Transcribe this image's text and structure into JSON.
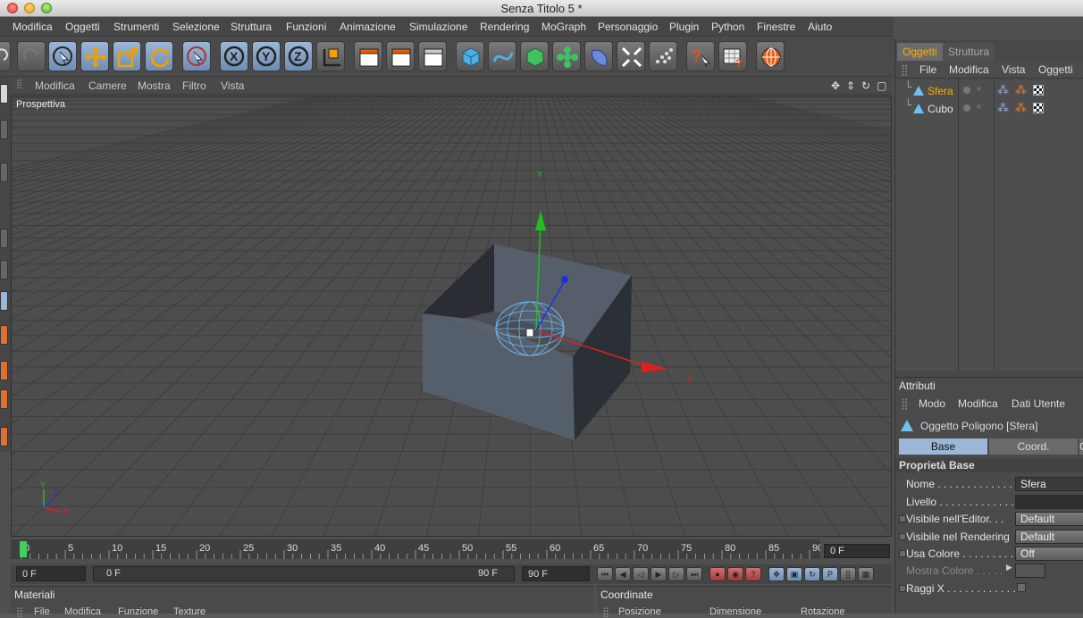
{
  "window": {
    "title": "Senza Titolo 5 *"
  },
  "menubar": [
    "Modifica",
    "Oggetti",
    "Strumenti",
    "Selezione",
    "Struttura",
    "Funzioni",
    "Animazione",
    "Simulazione",
    "Rendering",
    "MoGraph",
    "Personaggio",
    "Plugin",
    "Python",
    "Finestre",
    "Aiuto"
  ],
  "viewport": {
    "menu": [
      "Modifica",
      "Camere",
      "Mostra",
      "Filtro",
      "Vista"
    ],
    "label": "Prospettiva"
  },
  "timeline": {
    "ticks": [
      "0",
      "5",
      "10",
      "15",
      "20",
      "25",
      "30",
      "35",
      "40",
      "45",
      "50",
      "55",
      "60",
      "65",
      "70",
      "75",
      "80",
      "85",
      "90"
    ],
    "current_frame": "0 F"
  },
  "transport": {
    "start": "0 F",
    "range_start": "0 F",
    "range_end": "90 F",
    "end": "90 F"
  },
  "materials": {
    "title": "Materiali",
    "menu": [
      "File",
      "Modifica",
      "Funzione",
      "Texture"
    ]
  },
  "coordinates": {
    "title": "Coordinate",
    "columns": [
      "Posizione",
      "Dimensione",
      "Rotazione"
    ]
  },
  "object_manager": {
    "tabs": [
      "Oggetti",
      "Struttura"
    ],
    "menu": [
      "File",
      "Modifica",
      "Vista",
      "Oggetti"
    ],
    "objects": [
      {
        "name": "Sfera"
      },
      {
        "name": "Cubo"
      }
    ]
  },
  "attributes": {
    "title": "Attributi",
    "menu": [
      "Modo",
      "Modifica",
      "Dati Utente"
    ],
    "object_title": "Oggetto Poligono [Sfera]",
    "tabs": [
      "Base",
      "Coord.",
      "C"
    ],
    "section": "Proprietà Base",
    "rows": [
      {
        "label": "Nome . . . . . . . . . . . . . .",
        "value": "Sfera"
      },
      {
        "label": "Livello . . . . . . . . . . . . .",
        "value": ""
      },
      {
        "label": "Visibile nell'Editor. . .",
        "value": "Default"
      },
      {
        "label": "Visibile nel Rendering",
        "value": "Default"
      },
      {
        "label": "Usa Colore . . . . . . . . .",
        "value": "Off"
      },
      {
        "label": "Mostra Colore . . . . .",
        "value": ""
      },
      {
        "label": "Raggi X . . . . . . . . . . . .",
        "value": ""
      }
    ]
  },
  "colors": {
    "accent": "#ffb000",
    "selection": "#9bb6d6",
    "axis_x": "#e02020",
    "axis_y": "#20c020",
    "axis_z": "#2030e0"
  }
}
